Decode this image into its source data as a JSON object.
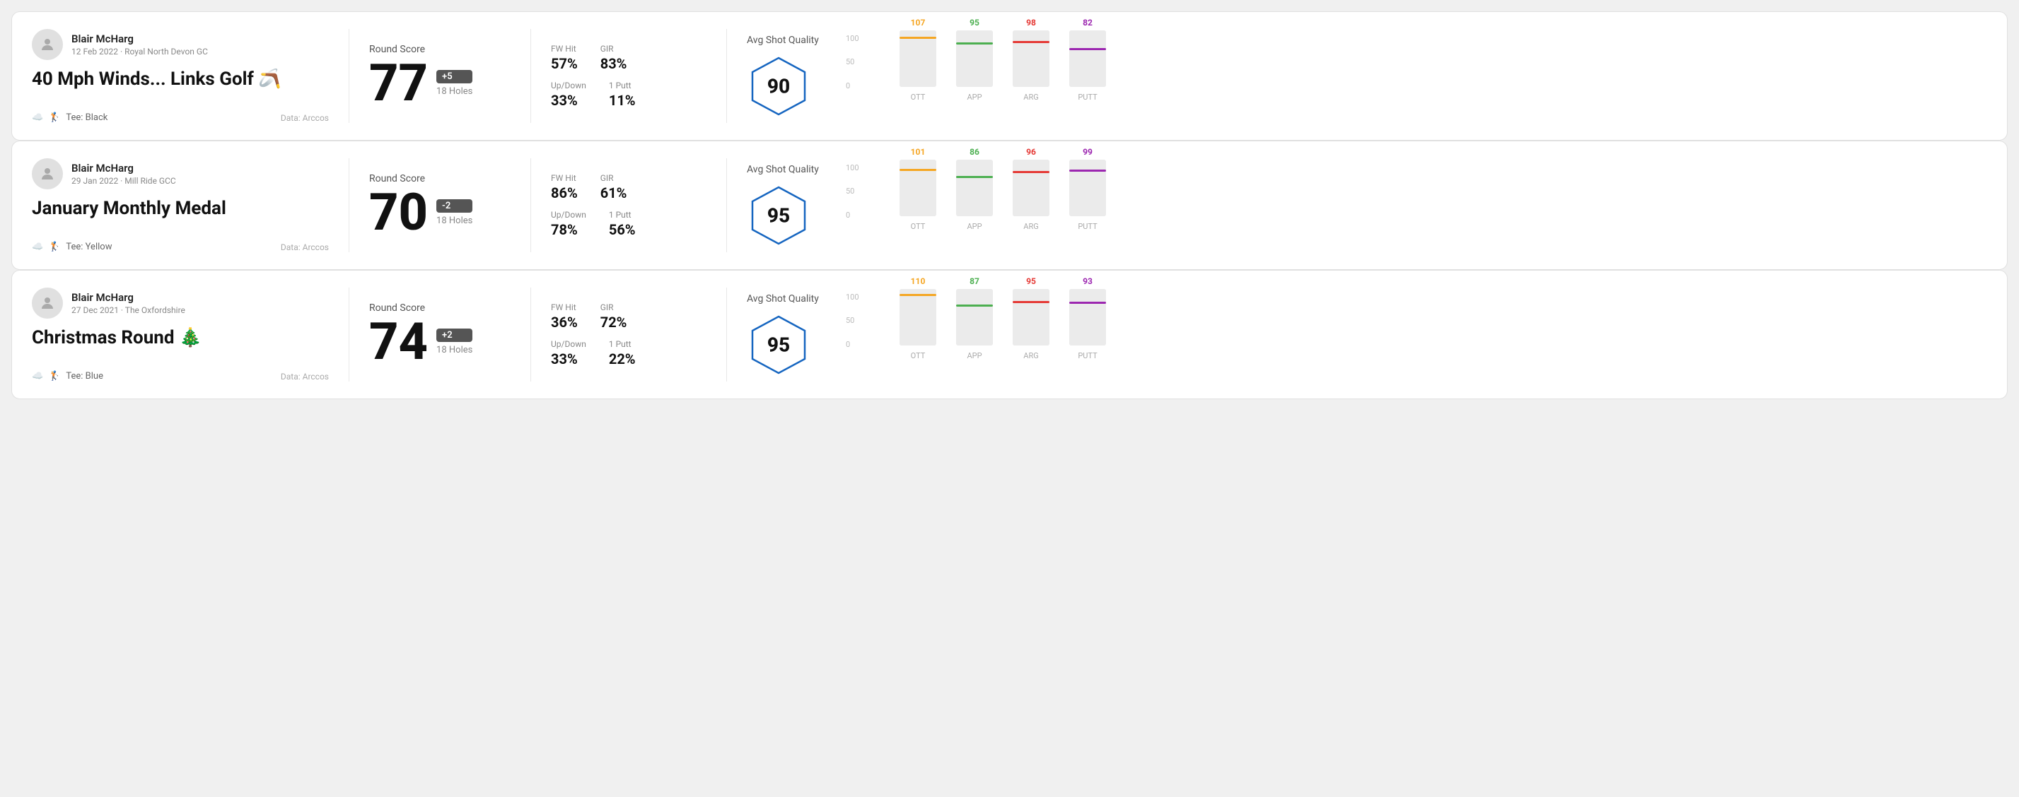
{
  "rounds": [
    {
      "id": "round1",
      "user": {
        "name": "Blair McHarg",
        "date": "12 Feb 2022 · Royal North Devon GC",
        "avatar": "👤"
      },
      "title": "40 Mph Winds... Links Golf",
      "title_emoji": "🪃",
      "tee": "Black",
      "data_source": "Data: Arccos",
      "score": {
        "label": "Round Score",
        "value": "77",
        "badge": "+5",
        "holes": "18 Holes"
      },
      "stats": {
        "fw_hit_label": "FW Hit",
        "fw_hit": "57%",
        "gir_label": "GIR",
        "gir": "83%",
        "updown_label": "Up/Down",
        "updown": "33%",
        "oneputt_label": "1 Putt",
        "oneputt": "11%"
      },
      "quality": {
        "label": "Avg Shot Quality",
        "score": "90"
      },
      "chart": {
        "bars": [
          {
            "label": "OTT",
            "value": 107,
            "color": "#f5a623",
            "pct": 75
          },
          {
            "label": "APP",
            "value": 95,
            "color": "#4caf50",
            "pct": 62
          },
          {
            "label": "ARG",
            "value": 98,
            "color": "#e53935",
            "pct": 65
          },
          {
            "label": "PUTT",
            "value": 82,
            "color": "#9c27b0",
            "pct": 55
          }
        ],
        "y_labels": [
          "100",
          "50",
          "0"
        ]
      }
    },
    {
      "id": "round2",
      "user": {
        "name": "Blair McHarg",
        "date": "29 Jan 2022 · Mill Ride GCC",
        "avatar": "👤"
      },
      "title": "January Monthly Medal",
      "title_emoji": "",
      "tee": "Yellow",
      "data_source": "Data: Arccos",
      "score": {
        "label": "Round Score",
        "value": "70",
        "badge": "-2",
        "holes": "18 Holes"
      },
      "stats": {
        "fw_hit_label": "FW Hit",
        "fw_hit": "86%",
        "gir_label": "GIR",
        "gir": "61%",
        "updown_label": "Up/Down",
        "updown": "78%",
        "oneputt_label": "1 Putt",
        "oneputt": "56%"
      },
      "quality": {
        "label": "Avg Shot Quality",
        "score": "95"
      },
      "chart": {
        "bars": [
          {
            "label": "OTT",
            "value": 101,
            "color": "#f5a623",
            "pct": 72
          },
          {
            "label": "APP",
            "value": 86,
            "color": "#4caf50",
            "pct": 58
          },
          {
            "label": "ARG",
            "value": 96,
            "color": "#e53935",
            "pct": 64
          },
          {
            "label": "PUTT",
            "value": 99,
            "color": "#9c27b0",
            "pct": 66
          }
        ],
        "y_labels": [
          "100",
          "50",
          "0"
        ]
      }
    },
    {
      "id": "round3",
      "user": {
        "name": "Blair McHarg",
        "date": "27 Dec 2021 · The Oxfordshire",
        "avatar": "👤"
      },
      "title": "Christmas Round",
      "title_emoji": "🎄",
      "tee": "Blue",
      "data_source": "Data: Arccos",
      "score": {
        "label": "Round Score",
        "value": "74",
        "badge": "+2",
        "holes": "18 Holes"
      },
      "stats": {
        "fw_hit_label": "FW Hit",
        "fw_hit": "36%",
        "gir_label": "GIR",
        "gir": "72%",
        "updown_label": "Up/Down",
        "updown": "33%",
        "oneputt_label": "1 Putt",
        "oneputt": "22%"
      },
      "quality": {
        "label": "Avg Shot Quality",
        "score": "95"
      },
      "chart": {
        "bars": [
          {
            "label": "OTT",
            "value": 110,
            "color": "#f5a623",
            "pct": 78
          },
          {
            "label": "APP",
            "value": 87,
            "color": "#4caf50",
            "pct": 58
          },
          {
            "label": "ARG",
            "value": 95,
            "color": "#e53935",
            "pct": 63
          },
          {
            "label": "PUTT",
            "value": 93,
            "color": "#9c27b0",
            "pct": 62
          }
        ],
        "y_labels": [
          "100",
          "50",
          "0"
        ]
      }
    }
  ]
}
